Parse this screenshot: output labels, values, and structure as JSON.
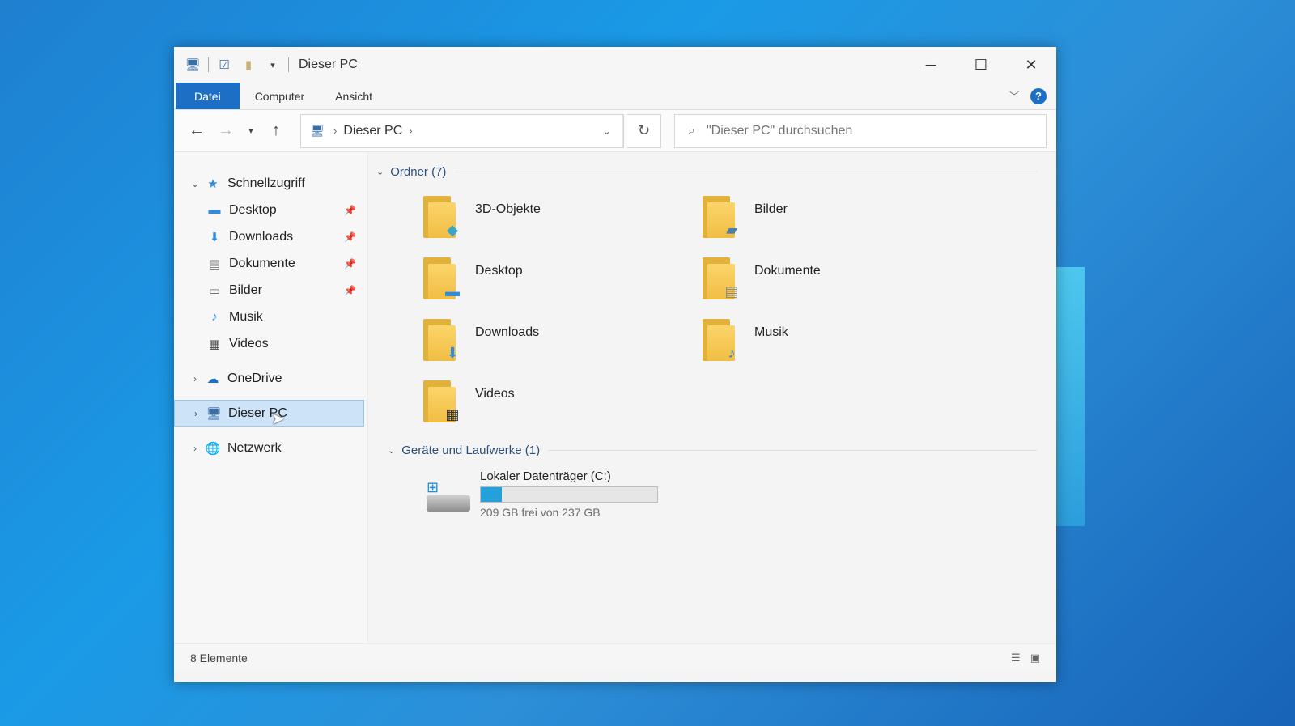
{
  "window": {
    "title": "Dieser PC",
    "controls": {
      "minimize": "─",
      "maximize": "☐",
      "close": "✕"
    }
  },
  "ribbon": {
    "tabs": [
      {
        "label": "Datei",
        "active": true
      },
      {
        "label": "Computer"
      },
      {
        "label": "Ansicht"
      }
    ],
    "help": "?"
  },
  "navigation": {
    "address": {
      "segment": "Dieser PC"
    },
    "search_placeholder": "\"Dieser PC\" durchsuchen"
  },
  "sidebar": {
    "quick_access": {
      "label": "Schnellzugriff",
      "items": [
        {
          "label": "Desktop",
          "icon": "desktop-icon",
          "pinned": true
        },
        {
          "label": "Downloads",
          "icon": "download-icon",
          "pinned": true
        },
        {
          "label": "Dokumente",
          "icon": "document-icon",
          "pinned": true
        },
        {
          "label": "Bilder",
          "icon": "pictures-icon",
          "pinned": true
        },
        {
          "label": "Musik",
          "icon": "music-icon",
          "pinned": false
        },
        {
          "label": "Videos",
          "icon": "video-icon",
          "pinned": false
        }
      ]
    },
    "onedrive": "OneDrive",
    "this_pc": "Dieser PC",
    "network": "Netzwerk"
  },
  "content": {
    "folders_header": "Ordner (7)",
    "folders": [
      {
        "name": "3D-Objekte",
        "badge": "cube-icon"
      },
      {
        "name": "Bilder",
        "badge": "landscape-icon"
      },
      {
        "name": "Desktop",
        "badge": "desktop-icon"
      },
      {
        "name": "Dokumente",
        "badge": "document-icon"
      },
      {
        "name": "Downloads",
        "badge": "download-icon"
      },
      {
        "name": "Musik",
        "badge": "music-icon"
      },
      {
        "name": "Videos",
        "badge": "film-icon"
      }
    ],
    "drives_header": "Geräte und Laufwerke (1)",
    "drives": [
      {
        "name": "Lokaler Datenträger (C:)",
        "free_text": "209 GB frei von 237 GB",
        "used_fraction": 0.12
      }
    ]
  },
  "status": {
    "item_count": "8 Elemente"
  },
  "colors": {
    "accent": "#1c6fc4",
    "drive_bar": "#26a0da",
    "folder": "#f1bd43"
  }
}
